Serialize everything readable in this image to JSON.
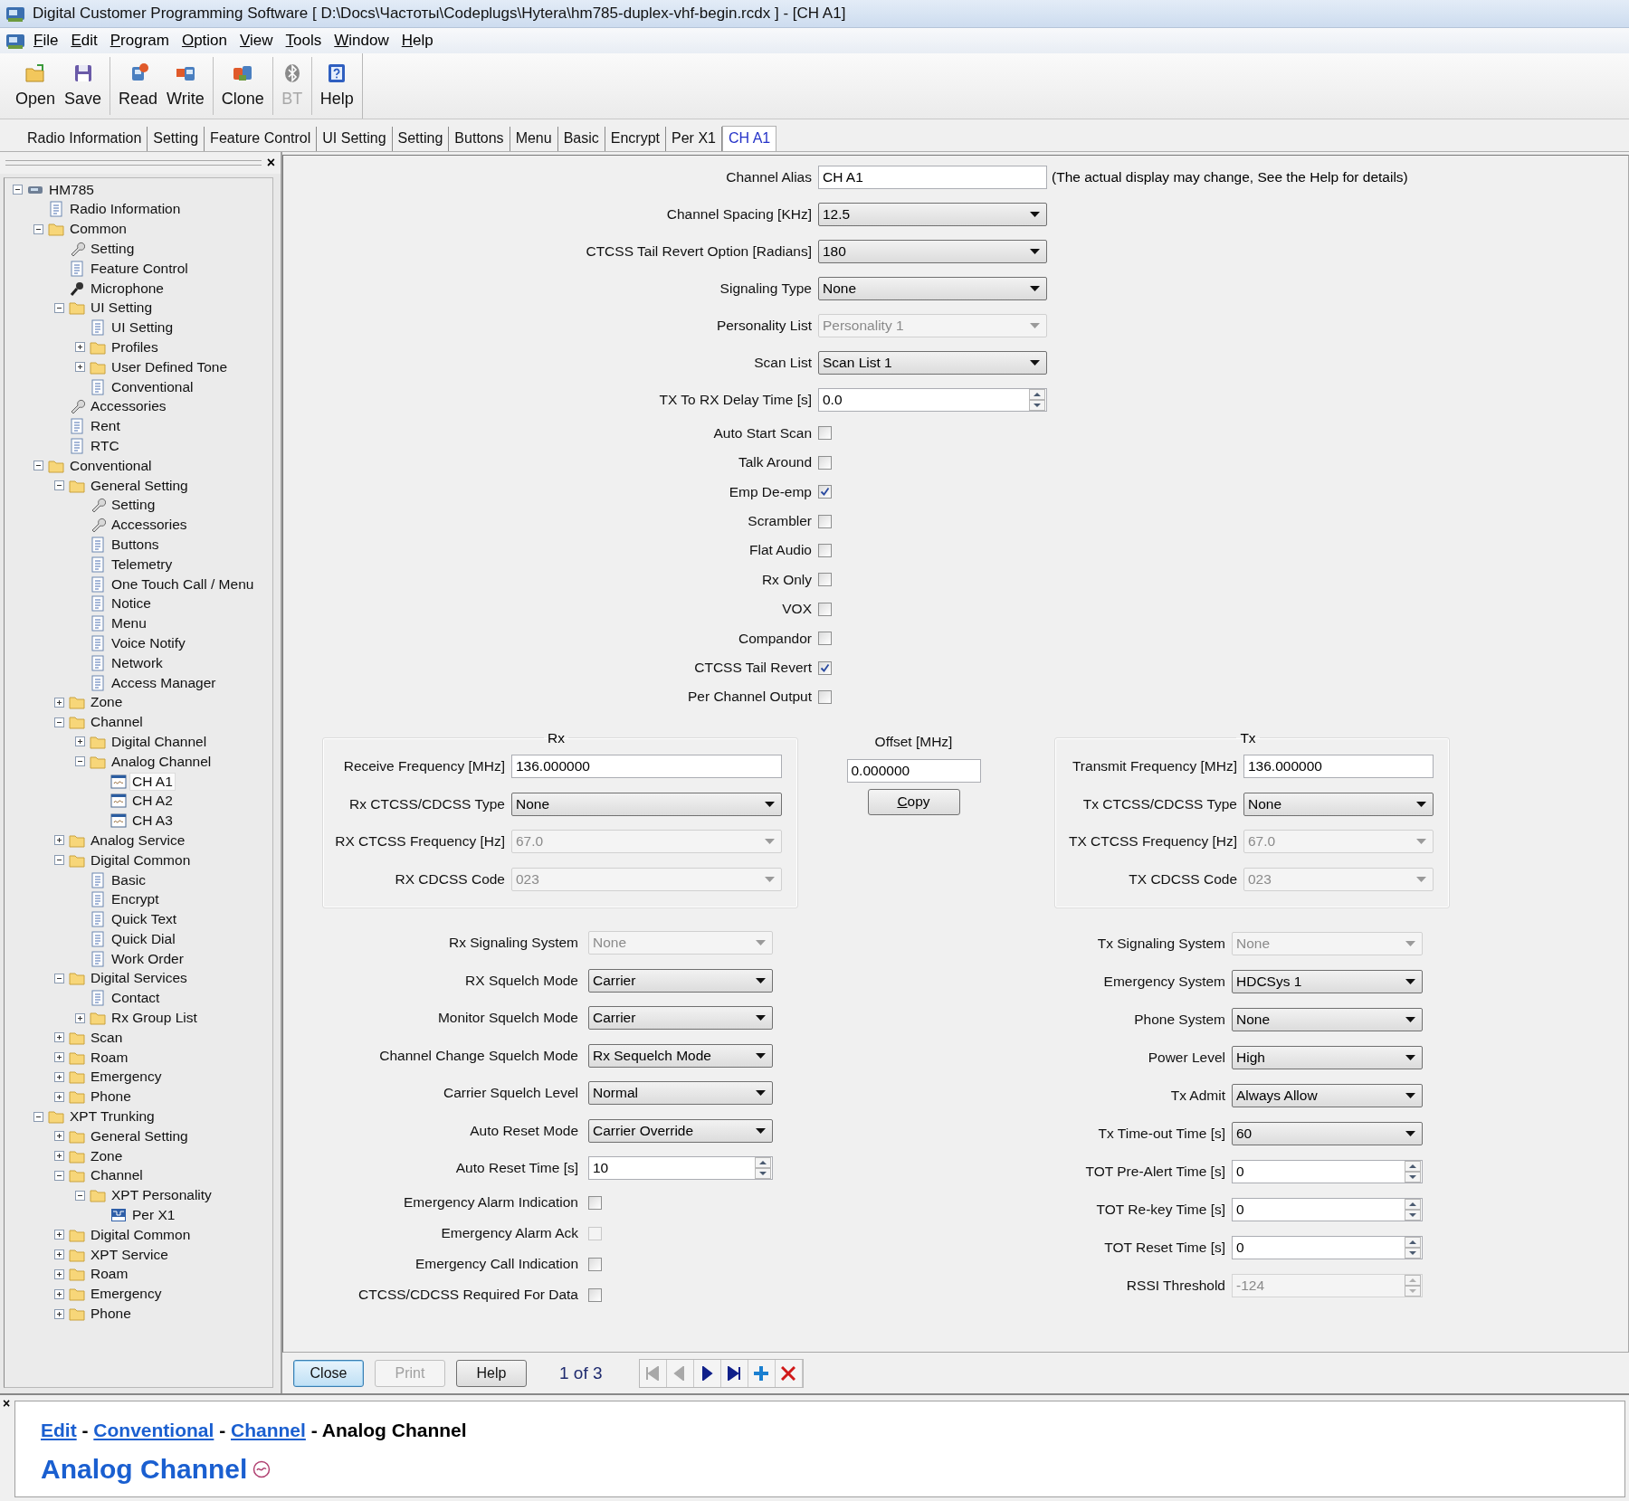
{
  "window": {
    "title": "Digital Customer Programming Software [ D:\\Docs\\Частоты\\Codeplugs\\Hytera\\hm785-duplex-vhf-begin.rcdx ] - [CH A1]"
  },
  "menu": [
    "File",
    "Edit",
    "Program",
    "Option",
    "View",
    "Tools",
    "Window",
    "Help"
  ],
  "toolbar": [
    [
      {
        "label": "Open",
        "disabled": false
      },
      {
        "label": "Save",
        "disabled": false
      }
    ],
    [
      {
        "label": "Read",
        "disabled": false
      },
      {
        "label": "Write",
        "disabled": false
      }
    ],
    [
      {
        "label": "Clone",
        "disabled": false
      }
    ],
    [
      {
        "label": "BT",
        "disabled": true
      }
    ],
    [
      {
        "label": "Help",
        "disabled": false
      }
    ]
  ],
  "tabs": [
    {
      "label": "Radio Information",
      "selected": false
    },
    {
      "label": "Setting",
      "selected": false
    },
    {
      "label": "Feature Control",
      "selected": false
    },
    {
      "label": "UI Setting",
      "selected": false
    },
    {
      "label": "Setting",
      "selected": false
    },
    {
      "label": "Buttons",
      "selected": false
    },
    {
      "label": "Menu",
      "selected": false
    },
    {
      "label": "Basic",
      "selected": false
    },
    {
      "label": "Encrypt",
      "selected": false
    },
    {
      "label": "Per X1",
      "selected": false
    },
    {
      "label": "CH A1",
      "selected": true
    }
  ],
  "tree": {
    "close": "×",
    "nodes": [
      {
        "label": "HM785",
        "kind": "device",
        "selected": false,
        "expanded": true,
        "children": [
          {
            "label": "Radio Information",
            "kind": "page",
            "selected": false
          },
          {
            "label": "Common",
            "kind": "folder",
            "selected": false,
            "expanded": true,
            "children": [
              {
                "label": "Setting",
                "kind": "tool",
                "selected": false
              },
              {
                "label": "Feature Control",
                "kind": "page",
                "selected": false
              },
              {
                "label": "Microphone",
                "kind": "mic",
                "selected": false
              },
              {
                "label": "UI Setting",
                "kind": "folder",
                "selected": false,
                "expanded": true,
                "children": [
                  {
                    "label": "UI Setting",
                    "kind": "page",
                    "selected": false
                  },
                  {
                    "label": "Profiles",
                    "kind": "folder",
                    "selected": false,
                    "expanded": false
                  },
                  {
                    "label": "User Defined Tone",
                    "kind": "folder",
                    "selected": false,
                    "expanded": false
                  },
                  {
                    "label": "Conventional",
                    "kind": "page",
                    "selected": false
                  }
                ]
              },
              {
                "label": "Accessories",
                "kind": "tool",
                "selected": false
              },
              {
                "label": "Rent",
                "kind": "page",
                "selected": false
              },
              {
                "label": "RTC",
                "kind": "page",
                "selected": false
              }
            ]
          },
          {
            "label": "Conventional",
            "kind": "folder",
            "selected": false,
            "expanded": true,
            "children": [
              {
                "label": "General Setting",
                "kind": "folder",
                "selected": false,
                "expanded": true,
                "children": [
                  {
                    "label": "Setting",
                    "kind": "tool",
                    "selected": false
                  },
                  {
                    "label": "Accessories",
                    "kind": "tool",
                    "selected": false
                  },
                  {
                    "label": "Buttons",
                    "kind": "page",
                    "selected": false
                  },
                  {
                    "label": "Telemetry",
                    "kind": "page",
                    "selected": false
                  },
                  {
                    "label": "One Touch Call / Menu",
                    "kind": "page",
                    "selected": false
                  },
                  {
                    "label": "Notice",
                    "kind": "page",
                    "selected": false
                  },
                  {
                    "label": "Menu",
                    "kind": "page",
                    "selected": false
                  },
                  {
                    "label": "Voice Notify",
                    "kind": "page",
                    "selected": false
                  },
                  {
                    "label": "Network",
                    "kind": "page",
                    "selected": false
                  },
                  {
                    "label": "Access Manager",
                    "kind": "page",
                    "selected": false
                  }
                ]
              },
              {
                "label": "Zone",
                "kind": "folder",
                "selected": false,
                "expanded": false
              },
              {
                "label": "Channel",
                "kind": "folder",
                "selected": false,
                "expanded": true,
                "children": [
                  {
                    "label": "Digital Channel",
                    "kind": "folder",
                    "selected": false,
                    "expanded": false
                  },
                  {
                    "label": "Analog Channel",
                    "kind": "folder",
                    "selected": false,
                    "expanded": true,
                    "children": [
                      {
                        "label": "CH A1",
                        "kind": "channel",
                        "selected": true
                      },
                      {
                        "label": "CH A2",
                        "kind": "channel",
                        "selected": false
                      },
                      {
                        "label": "CH A3",
                        "kind": "channel",
                        "selected": false
                      }
                    ]
                  }
                ]
              },
              {
                "label": "Analog Service",
                "kind": "folder",
                "selected": false,
                "expanded": false
              },
              {
                "label": "Digital Common",
                "kind": "folder",
                "selected": false,
                "expanded": true,
                "children": [
                  {
                    "label": "Basic",
                    "kind": "page",
                    "selected": false
                  },
                  {
                    "label": "Encrypt",
                    "kind": "page",
                    "selected": false
                  },
                  {
                    "label": "Quick Text",
                    "kind": "page",
                    "selected": false
                  },
                  {
                    "label": "Quick Dial",
                    "kind": "page",
                    "selected": false
                  },
                  {
                    "label": "Work Order",
                    "kind": "page",
                    "selected": false
                  }
                ]
              },
              {
                "label": "Digital Services",
                "kind": "folder",
                "selected": false,
                "expanded": true,
                "children": [
                  {
                    "label": "Contact",
                    "kind": "page",
                    "selected": false
                  },
                  {
                    "label": "Rx Group List",
                    "kind": "folder",
                    "selected": false,
                    "expanded": false
                  }
                ]
              },
              {
                "label": "Scan",
                "kind": "folder",
                "selected": false,
                "expanded": false
              },
              {
                "label": "Roam",
                "kind": "folder",
                "selected": false,
                "expanded": false
              },
              {
                "label": "Emergency",
                "kind": "folder",
                "selected": false,
                "expanded": false
              },
              {
                "label": "Phone",
                "kind": "folder",
                "selected": false,
                "expanded": false
              }
            ]
          },
          {
            "label": "XPT Trunking",
            "kind": "folder",
            "selected": false,
            "expanded": true,
            "children": [
              {
                "label": "General Setting",
                "kind": "folder",
                "selected": false,
                "expanded": false
              },
              {
                "label": "Zone",
                "kind": "folder",
                "selected": false,
                "expanded": false
              },
              {
                "label": "Channel",
                "kind": "folder",
                "selected": false,
                "expanded": true,
                "children": [
                  {
                    "label": "XPT Personality",
                    "kind": "folder",
                    "selected": false,
                    "expanded": true,
                    "children": [
                      {
                        "label": "Per X1",
                        "kind": "xpt",
                        "selected": false
                      }
                    ]
                  }
                ]
              },
              {
                "label": "Digital Common",
                "kind": "folder",
                "selected": false,
                "expanded": false
              },
              {
                "label": "XPT Service",
                "kind": "folder",
                "selected": false,
                "expanded": false
              },
              {
                "label": "Roam",
                "kind": "folder",
                "selected": false,
                "expanded": false
              },
              {
                "label": "Emergency",
                "kind": "folder",
                "selected": false,
                "expanded": false
              },
              {
                "label": "Phone",
                "kind": "folder",
                "selected": false,
                "expanded": false
              }
            ]
          }
        ]
      }
    ]
  },
  "form": {
    "top_fields": [
      {
        "label": "Channel Alias",
        "kind": "text",
        "value": "CH A1",
        "disabled": false,
        "note": "(The actual display may change, See the Help for details)"
      },
      {
        "label": "Channel Spacing [KHz]",
        "kind": "select",
        "value": "12.5",
        "disabled": false
      },
      {
        "label": "CTCSS Tail Revert Option [Radians]",
        "kind": "select",
        "value": "180",
        "disabled": false
      },
      {
        "label": "Signaling Type",
        "kind": "select",
        "value": "None",
        "disabled": false
      },
      {
        "label": "Personality List",
        "kind": "select",
        "value": "Personality 1",
        "disabled": true
      },
      {
        "label": "Scan List",
        "kind": "select",
        "value": "Scan List 1",
        "disabled": false
      },
      {
        "label": "TX To RX Delay Time [s]",
        "kind": "spin",
        "value": "0.0",
        "disabled": false
      },
      {
        "label": "Auto Start Scan",
        "kind": "checkbox",
        "checked": false,
        "disabled": false
      },
      {
        "label": "Talk Around",
        "kind": "checkbox",
        "checked": false,
        "disabled": false
      },
      {
        "label": "Emp De-emp",
        "kind": "checkbox",
        "checked": true,
        "disabled": false
      },
      {
        "label": "Scrambler",
        "kind": "checkbox",
        "checked": false,
        "disabled": false
      },
      {
        "label": "Flat Audio",
        "kind": "checkbox",
        "checked": false,
        "disabled": false
      },
      {
        "label": "Rx Only",
        "kind": "checkbox",
        "checked": false,
        "disabled": false
      },
      {
        "label": "VOX",
        "kind": "checkbox",
        "checked": false,
        "disabled": false
      },
      {
        "label": "Compandor",
        "kind": "checkbox",
        "checked": false,
        "disabled": false
      },
      {
        "label": "CTCSS Tail Revert",
        "kind": "checkbox",
        "checked": true,
        "disabled": false
      },
      {
        "label": "Per Channel Output",
        "kind": "checkbox",
        "checked": false,
        "disabled": false
      }
    ],
    "rx": {
      "title": "Rx",
      "fields": [
        {
          "label": "Receive Frequency [MHz]",
          "kind": "text",
          "value": "136.000000",
          "disabled": false
        },
        {
          "label": "Rx CTCSS/CDCSS Type",
          "kind": "select",
          "value": "None",
          "disabled": false
        },
        {
          "label": "RX CTCSS Frequency [Hz]",
          "kind": "select",
          "value": "67.0",
          "disabled": true
        },
        {
          "label": "RX CDCSS Code",
          "kind": "select",
          "value": "023",
          "disabled": true
        }
      ]
    },
    "offset": {
      "label": "Offset [MHz]",
      "value": "0.000000",
      "button": "Copy"
    },
    "tx": {
      "title": "Tx",
      "fields": [
        {
          "label": "Transmit Frequency [MHz]",
          "kind": "text",
          "value": "136.000000",
          "disabled": false
        },
        {
          "label": "Tx CTCSS/CDCSS Type",
          "kind": "select",
          "value": "None",
          "disabled": false
        },
        {
          "label": "TX CTCSS Frequency [Hz]",
          "kind": "select",
          "value": "67.0",
          "disabled": true
        },
        {
          "label": "TX CDCSS Code",
          "kind": "select",
          "value": "023",
          "disabled": true
        }
      ]
    },
    "left_fields": [
      {
        "label": "Rx Signaling System",
        "kind": "select",
        "value": "None",
        "disabled": true
      },
      {
        "label": "RX Squelch Mode",
        "kind": "select",
        "value": "Carrier",
        "disabled": false
      },
      {
        "label": "Monitor Squelch Mode",
        "kind": "select",
        "value": "Carrier",
        "disabled": false
      },
      {
        "label": "Channel Change Squelch Mode",
        "kind": "select",
        "value": "Rx Sequelch Mode",
        "disabled": false
      },
      {
        "label": "Carrier Squelch Level",
        "kind": "select",
        "value": "Normal",
        "disabled": false
      },
      {
        "label": "Auto Reset Mode",
        "kind": "select",
        "value": "Carrier Override",
        "disabled": false
      },
      {
        "label": "Auto Reset Time [s]",
        "kind": "spin",
        "value": "10",
        "disabled": false
      },
      {
        "label": "Emergency Alarm Indication",
        "kind": "checkbox",
        "checked": false,
        "disabled": false
      },
      {
        "label": "Emergency Alarm Ack",
        "kind": "checkbox",
        "checked": false,
        "disabled": true
      },
      {
        "label": "Emergency Call Indication",
        "kind": "checkbox",
        "checked": false,
        "disabled": false
      },
      {
        "label": "CTCSS/CDCSS Required For Data",
        "kind": "checkbox",
        "checked": false,
        "disabled": false
      }
    ],
    "right_fields": [
      {
        "label": "Tx Signaling System",
        "kind": "select",
        "value": "None",
        "disabled": true
      },
      {
        "label": "Emergency System",
        "kind": "select",
        "value": "HDCSys 1",
        "disabled": false
      },
      {
        "label": "Phone System",
        "kind": "select",
        "value": "None",
        "disabled": false
      },
      {
        "label": "Power Level",
        "kind": "select",
        "value": "High",
        "disabled": false
      },
      {
        "label": "Tx Admit",
        "kind": "select",
        "value": "Always Allow",
        "disabled": false
      },
      {
        "label": "Tx Time-out Time [s]",
        "kind": "select",
        "value": "60",
        "disabled": false
      },
      {
        "label": "TOT Pre-Alert Time [s]",
        "kind": "spin",
        "value": "0",
        "disabled": false
      },
      {
        "label": "TOT Re-key Time [s]",
        "kind": "spin",
        "value": "0",
        "disabled": false
      },
      {
        "label": "TOT Reset Time [s]",
        "kind": "spin",
        "value": "0",
        "disabled": false
      },
      {
        "label": "RSSI Threshold",
        "kind": "spin",
        "value": "-124",
        "disabled": true
      }
    ]
  },
  "footer": {
    "buttons": [
      {
        "label": "Close",
        "disabled": false,
        "default": true
      },
      {
        "label": "Print",
        "disabled": true,
        "default": false
      },
      {
        "label": "Help",
        "disabled": false,
        "default": false
      }
    ],
    "page": "1 of 3",
    "nav": [
      {
        "disabled": true
      },
      {
        "disabled": true
      },
      {
        "disabled": false
      },
      {
        "disabled": false
      },
      {
        "disabled": false
      },
      {
        "disabled": false
      }
    ]
  },
  "help": {
    "close": "×",
    "breadcrumb": [
      {
        "text": "Edit",
        "link": true
      },
      {
        "text": "Conventional",
        "link": true
      },
      {
        "text": "Channel",
        "link": true
      },
      {
        "text": "Analog Channel",
        "link": false
      }
    ],
    "separator": " - ",
    "heading": "Analog Channel"
  }
}
